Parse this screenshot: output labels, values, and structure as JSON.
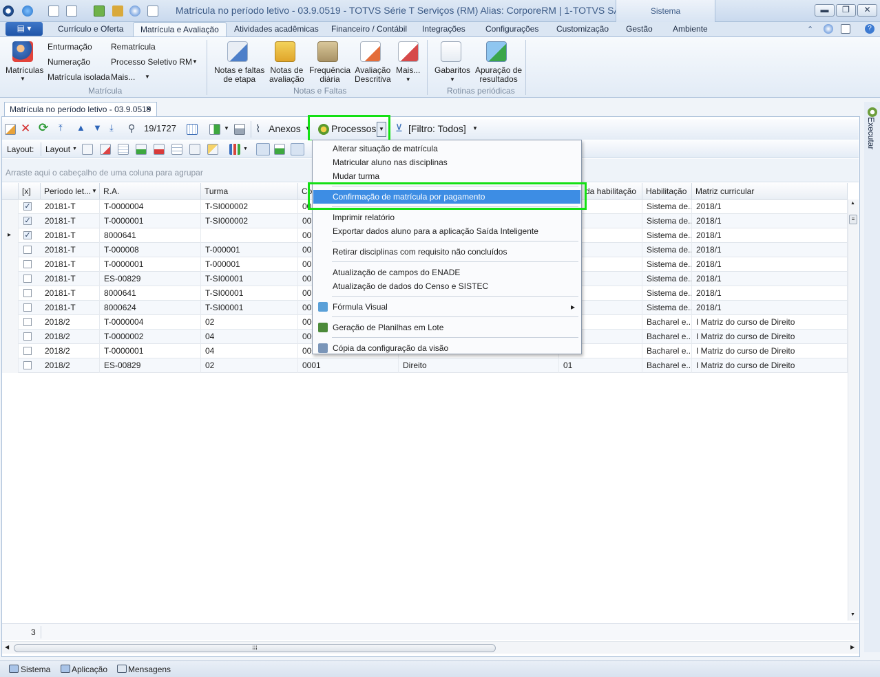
{
  "window": {
    "title": "Matrícula no período letivo - 03.9.0519 - TOTVS Série T Serviços (RM) Alias: CorporeRM | 1-TOTVS SA",
    "context_tab": "Sistema",
    "minimize": "▬",
    "restore": "❐",
    "close": "✕"
  },
  "ribbon": {
    "app_button": "▤ ▾",
    "tabs": [
      "Currículo e Oferta",
      "Matrícula e Avaliação",
      "Atividades acadêmicas",
      "Financeiro / Contábil",
      "Integrações",
      "Configurações",
      "Customização",
      "Gestão",
      "Ambiente"
    ],
    "matricula_group": {
      "big": "Matrículas",
      "small": [
        "Enturmação",
        "Numeração",
        "Matrícula isolada",
        "Rematrícula",
        "Processo Seletivo RM",
        "Mais..."
      ],
      "label": "Matrícula"
    },
    "notas_group": {
      "buttons": [
        "Notas e faltas|de etapa",
        "Notas de|avaliação",
        "Frequência|diária",
        "Avaliação|Descritiva",
        "Mais..."
      ],
      "label": "Notas e Faltas"
    },
    "rotinas_group": {
      "buttons": [
        "Gabaritos",
        "Apuração de|resultados"
      ],
      "label": "Rotinas periódicas"
    }
  },
  "doc_tab": {
    "label": "Matrícula no período letivo - 03.9.0519",
    "close": "✕"
  },
  "toolbar": {
    "record_counter": "19/1727",
    "anexos": "Anexos",
    "processos": "Processos",
    "filtro": "[Filtro: Todos]",
    "layout_label": "Layout:",
    "layout_menu": "Layout"
  },
  "group_panel": "Arraste aqui o cabeçalho de uma coluna para agrupar",
  "grid": {
    "headers": [
      "[x]",
      "Período let...",
      "R.A.",
      "Turma",
      "Co",
      "",
      "da habilitação",
      "Habilitação",
      "Matriz curricular"
    ],
    "rows": [
      {
        "checked": true,
        "periodo": "20181-T",
        "ra": "T-0000004",
        "turma": "T-SI000002",
        "cod": "001",
        "curso": "",
        "hab_cod": "",
        "hab": "Sistema de...",
        "matriz": "2018/1"
      },
      {
        "checked": true,
        "periodo": "20181-T",
        "ra": "T-0000001",
        "turma": "T-SI000002",
        "cod": "001",
        "curso": "",
        "hab_cod": "",
        "hab": "Sistema de...",
        "matriz": "2018/1"
      },
      {
        "checked": true,
        "current": true,
        "periodo": "20181-T",
        "ra": "8000641",
        "turma": "",
        "cod": "001",
        "curso": "",
        "hab_cod": "",
        "hab": "Sistema de...",
        "matriz": "2018/1"
      },
      {
        "checked": false,
        "periodo": "20181-T",
        "ra": "T-000008",
        "turma": "T-000001",
        "cod": "001",
        "curso": "",
        "hab_cod": "",
        "hab": "Sistema de...",
        "matriz": "2018/1"
      },
      {
        "checked": false,
        "periodo": "20181-T",
        "ra": "T-0000001",
        "turma": "T-000001",
        "cod": "001",
        "curso": "",
        "hab_cod": "",
        "hab": "Sistema de...",
        "matriz": "2018/1"
      },
      {
        "checked": false,
        "periodo": "20181-T",
        "ra": "ES-00829",
        "turma": "T-SI00001",
        "cod": "001",
        "curso": "",
        "hab_cod": "",
        "hab": "Sistema de...",
        "matriz": "2018/1"
      },
      {
        "checked": false,
        "periodo": "20181-T",
        "ra": "8000641",
        "turma": "T-SI00001",
        "cod": "001",
        "curso": "",
        "hab_cod": "",
        "hab": "Sistema de...",
        "matriz": "2018/1"
      },
      {
        "checked": false,
        "periodo": "20181-T",
        "ra": "8000624",
        "turma": "T-SI00001",
        "cod": "001",
        "curso": "",
        "hab_cod": "",
        "hab": "Sistema de...",
        "matriz": "2018/1"
      },
      {
        "checked": false,
        "periodo": "2018/2",
        "ra": "T-0000004",
        "turma": "02",
        "cod": "000",
        "curso": "",
        "hab_cod": "",
        "hab": "Bacharel e...",
        "matriz": "I Matriz do curso de Direito"
      },
      {
        "checked": false,
        "periodo": "2018/2",
        "ra": "T-0000002",
        "turma": "04",
        "cod": "000",
        "curso": "",
        "hab_cod": "",
        "hab": "Bacharel e...",
        "matriz": "I Matriz do curso de Direito"
      },
      {
        "checked": false,
        "periodo": "2018/2",
        "ra": "T-0000001",
        "turma": "04",
        "cod": "000",
        "curso": "",
        "hab_cod": "",
        "hab": "Bacharel e...",
        "matriz": "I Matriz do curso de Direito"
      },
      {
        "checked": false,
        "periodo": "2018/2",
        "ra": "ES-00829",
        "turma": "02",
        "cod": "0001",
        "curso": "Direito",
        "hab_cod": "01",
        "hab": "Bacharel e...",
        "matriz": "I Matriz do curso de Direito"
      }
    ],
    "footer_count": "3"
  },
  "menu": {
    "items": [
      {
        "label": "Alterar situação de matrícula",
        "sep_after": false
      },
      {
        "label": "Matricular aluno nas disciplinas",
        "sep_after": false
      },
      {
        "label": "Mudar turma",
        "sep_after": true
      },
      {
        "label": "Confirmação de matrícula por pagamento",
        "highlight": true,
        "sep_after": true
      },
      {
        "label": "Imprimir relatório",
        "sep_after": false
      },
      {
        "label": "Exportar dados aluno para a aplicação Saída Inteligente",
        "sep_after": true
      },
      {
        "label": "Retirar disciplinas com requisito não concluídos",
        "sep_after": true
      },
      {
        "label": "Atualização de campos do ENADE",
        "sep_after": false
      },
      {
        "label": "Atualização de dados do Censo e SISTEC",
        "sep_after": true
      },
      {
        "label": "Fórmula Visual",
        "icon": true,
        "submenu": true,
        "sep_after": true
      },
      {
        "label": "Geração de Planilhas em Lote",
        "icon": true,
        "sep_after": true
      },
      {
        "label": "Cópia da configuração da visão",
        "icon": true,
        "sep_after": false
      }
    ]
  },
  "side_panel": {
    "label": "Executar"
  },
  "statusbar": [
    "Sistema",
    "Aplicação",
    "Mensagens"
  ],
  "colors": {
    "accent": "#3d8de4",
    "highlight_box": "#14e014",
    "title_text": "#3b5a86"
  }
}
